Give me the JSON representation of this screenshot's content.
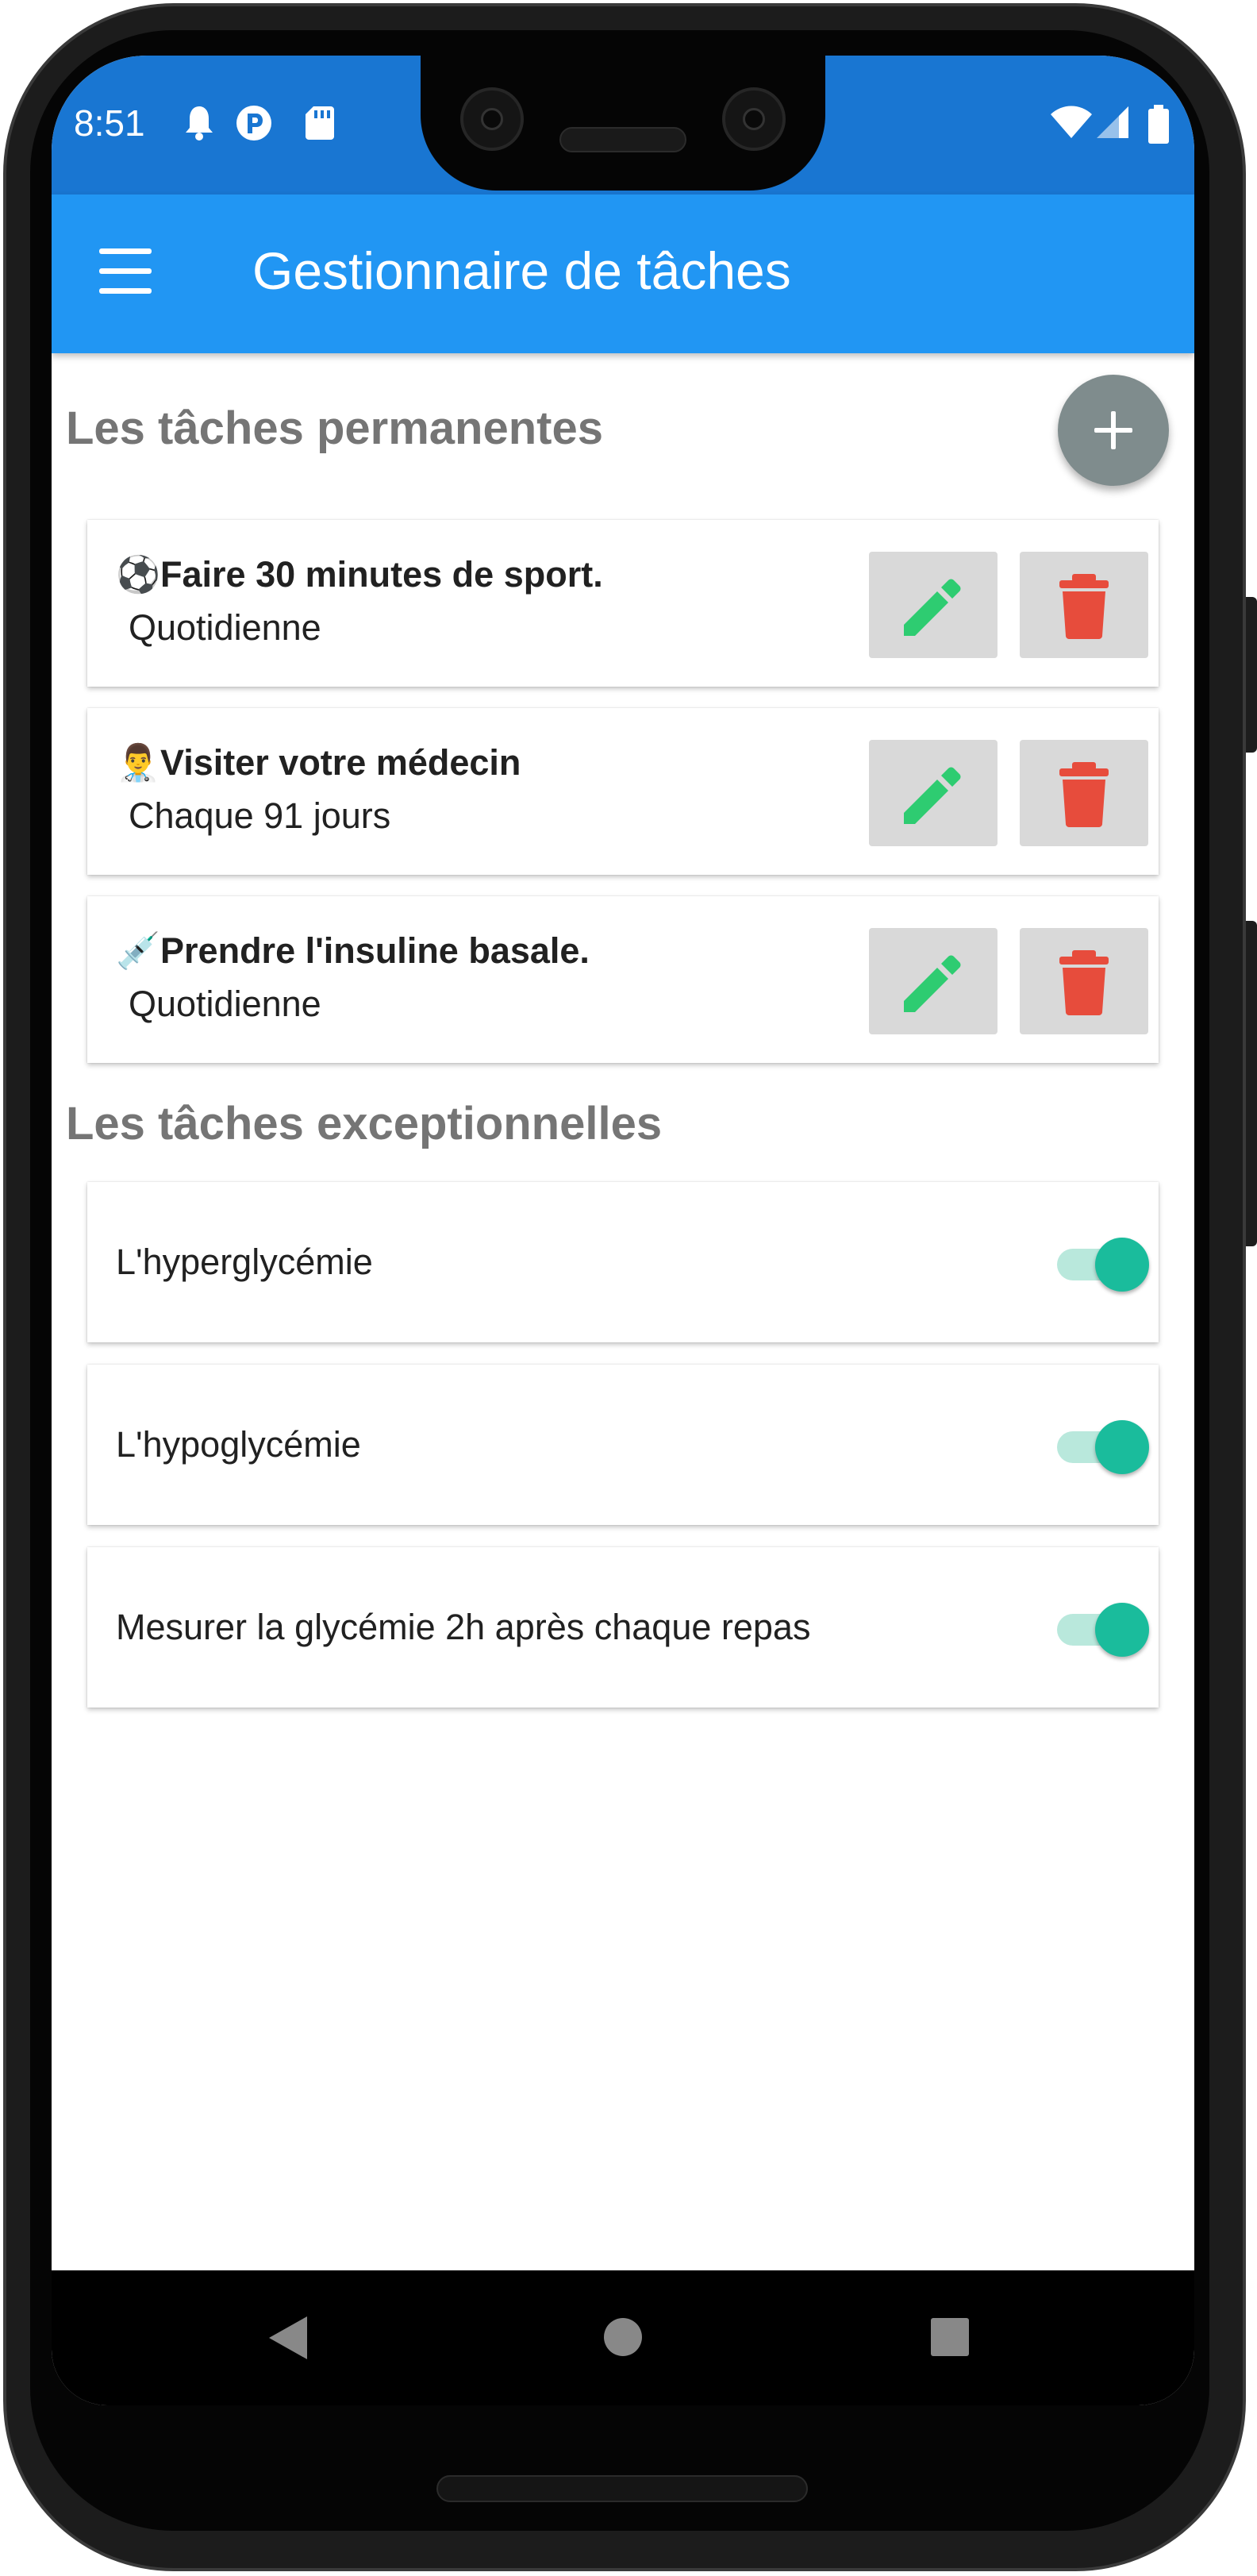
{
  "status_bar": {
    "time": "8:51",
    "left_icons": [
      "bell-icon",
      "app-badge-icon",
      "sd-card-icon"
    ],
    "right_icons": [
      "wifi-icon",
      "signal-icon",
      "battery-icon"
    ]
  },
  "app_bar": {
    "title": "Gestionnaire de tâches",
    "menu_icon": "hamburger-menu-icon",
    "color": "#2196f3"
  },
  "permanent_tasks": {
    "title": "Les tâches permanentes",
    "add_icon": "plus-icon",
    "items": [
      {
        "emoji": "⚽",
        "label": "Faire 30 minutes de sport.",
        "frequency": "Quotidienne",
        "icon": "soccer-ball-icon"
      },
      {
        "emoji": "👨‍⚕️",
        "label": "Visiter votre médecin",
        "frequency": "Chaque 91 jours",
        "icon": "doctor-icon"
      },
      {
        "emoji": "💉",
        "label": "Prendre l'insuline basale.",
        "frequency": "Quotidienne",
        "icon": "syringe-icon"
      }
    ],
    "edit_color": "#2ecc71",
    "delete_color": "#e74c3c"
  },
  "exceptional_tasks": {
    "title": "Les tâches exceptionnelles",
    "items": [
      {
        "label": "L'hyperglycémie",
        "enabled": true
      },
      {
        "label": "L'hypoglycémie",
        "enabled": true
      },
      {
        "label": "Mesurer la glycémie 2h après chaque repas",
        "enabled": true
      }
    ],
    "toggle_color": "#1abc9c"
  },
  "nav_bar": {
    "icons": [
      "back-icon",
      "home-icon",
      "recents-icon"
    ]
  }
}
